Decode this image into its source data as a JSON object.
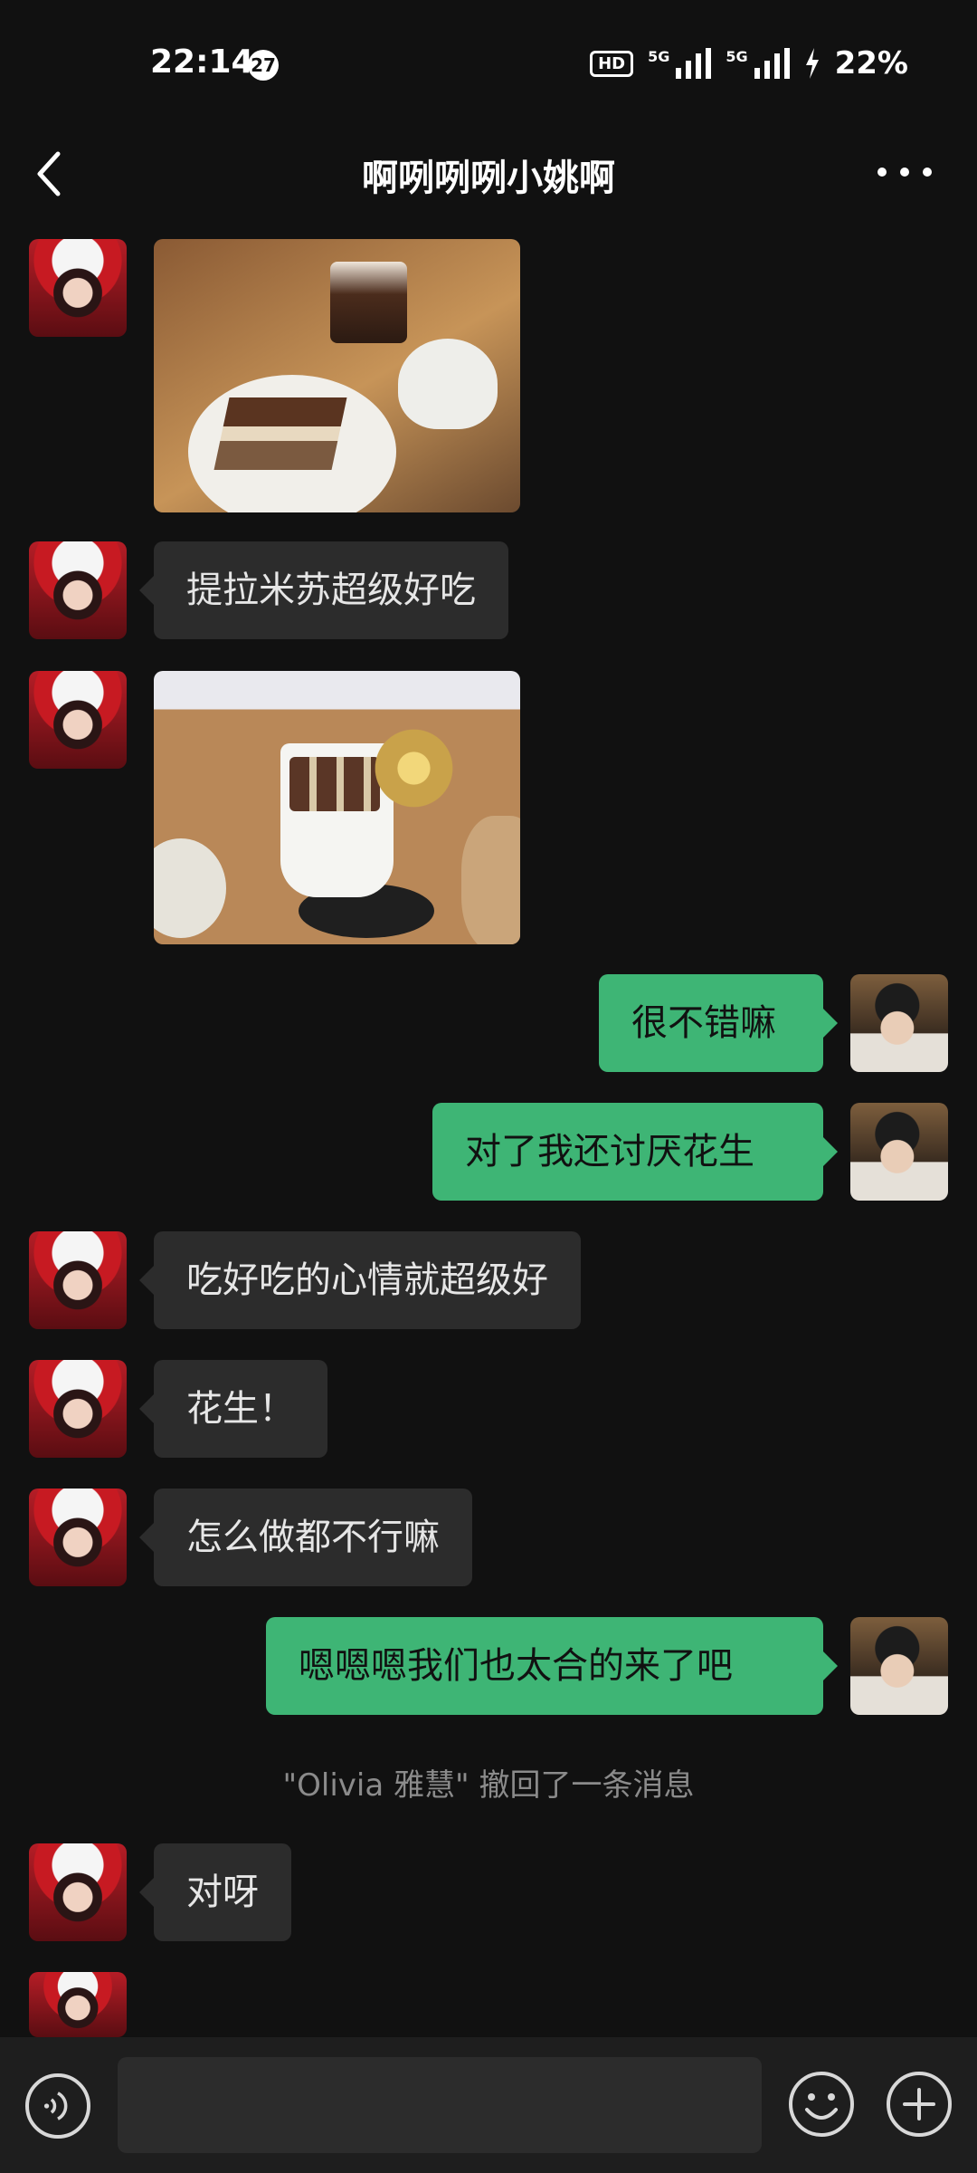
{
  "status_bar": {
    "time": "22:14",
    "notification_count": "27",
    "hd_label": "HD",
    "network_1": "5G",
    "network_2": "5G",
    "battery": "22%"
  },
  "header": {
    "title": "啊咧咧咧小姚啊"
  },
  "messages": [
    {
      "sender": "them",
      "type": "image",
      "image_desc": "tiramisu and drinks on wooden table"
    },
    {
      "sender": "them",
      "type": "text",
      "text": "提拉米苏超级好吃"
    },
    {
      "sender": "them",
      "type": "image",
      "image_desc": "iced drink with dried flower garnish"
    },
    {
      "sender": "me",
      "type": "text",
      "text": "很不错嘛"
    },
    {
      "sender": "me",
      "type": "text",
      "text": "对了我还讨厌花生"
    },
    {
      "sender": "them",
      "type": "text",
      "text": "吃好吃的心情就超级好"
    },
    {
      "sender": "them",
      "type": "text",
      "text": "花生！"
    },
    {
      "sender": "them",
      "type": "text",
      "text": "怎么做都不行嘛"
    },
    {
      "sender": "me",
      "type": "text",
      "text": "嗯嗯嗯我们也太合的来了吧"
    },
    {
      "sender": "system",
      "type": "recall",
      "text": "\"Olivia 雅慧\" 撤回了一条消息"
    },
    {
      "sender": "them",
      "type": "text",
      "text": "对呀"
    }
  ],
  "input_bar": {
    "placeholder": "",
    "voice_icon": "voice-icon",
    "emoji_icon": "emoji-icon",
    "plus_icon": "plus-icon"
  },
  "colors": {
    "background": "#111111",
    "incoming_bubble": "#2c2c2c",
    "outgoing_bubble": "#3eb575"
  }
}
